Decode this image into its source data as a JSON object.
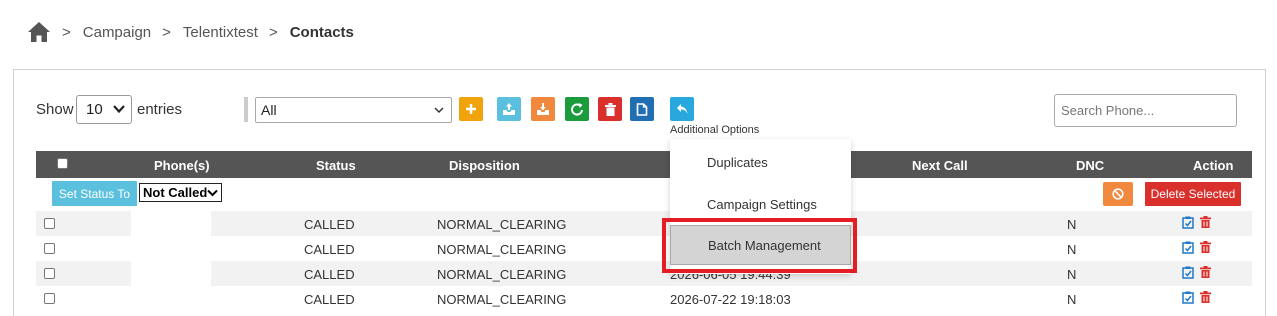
{
  "breadcrumb": {
    "home_icon": "home-icon",
    "items": [
      "Campaign",
      "Telentixtest"
    ],
    "current": "Contacts",
    "separator": ">"
  },
  "length": {
    "show": "Show",
    "value": "10",
    "entries": "entries"
  },
  "filter": {
    "value": "All"
  },
  "toolbar": {
    "buttons": [
      {
        "name": "add-button",
        "icon": "plus-icon",
        "color": "#f0a30a"
      },
      {
        "name": "import-button",
        "icon": "upload-icon",
        "color": "#5bc0de"
      },
      {
        "name": "export-button",
        "icon": "download-icon",
        "color": "#f0883e"
      },
      {
        "name": "refresh-button",
        "icon": "refresh-icon",
        "color": "#1a9c3d"
      },
      {
        "name": "delete-button",
        "icon": "trash-icon",
        "color": "#d9302c"
      },
      {
        "name": "copy-button",
        "icon": "document-icon",
        "color": "#1f6fb2"
      },
      {
        "name": "additional-options-button",
        "icon": "reply-icon",
        "color": "#29a8e0"
      }
    ]
  },
  "search": {
    "placeholder": "Search Phone..."
  },
  "table": {
    "headers": {
      "phone": "Phone(s)",
      "status": "Status",
      "disposition": "Disposition",
      "next_call": "Next Call",
      "dnc": "DNC",
      "action": "Action"
    },
    "set_status_label": "Set Status To",
    "set_status_value": "Not Called",
    "delete_selected_label": "Delete Selected",
    "rows": [
      {
        "phone": "",
        "status": "CALLED",
        "disposition": "NORMAL_CLEARING",
        "next_call": "",
        "dnc": "N"
      },
      {
        "phone": "",
        "status": "CALLED",
        "disposition": "NORMAL_CLEARING",
        "next_call": "",
        "dnc": "N"
      },
      {
        "phone": "",
        "status": "CALLED",
        "disposition": "NORMAL_CLEARING",
        "next_call": "2026-06-05 19:44:39",
        "dnc": "N"
      },
      {
        "phone": "",
        "status": "CALLED",
        "disposition": "NORMAL_CLEARING",
        "next_call": "2026-07-22 19:18:03",
        "dnc": "N"
      }
    ]
  },
  "menu": {
    "header": "Additional Options",
    "items": [
      "Duplicates",
      "Campaign Settings",
      "Batch Management"
    ],
    "active_index": 2,
    "highlight_color": "#e41d25"
  }
}
